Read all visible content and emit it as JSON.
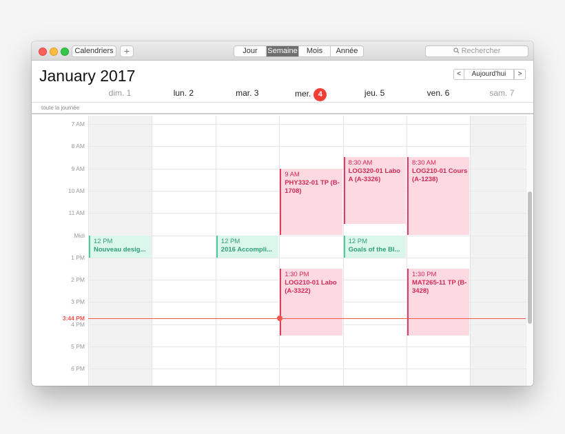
{
  "toolbar": {
    "calendars_label": "Calendriers",
    "add_label": "+",
    "views": [
      {
        "label": "Jour",
        "active": false
      },
      {
        "label": "Semaine",
        "active": true
      },
      {
        "label": "Mois",
        "active": false
      },
      {
        "label": "Année",
        "active": false
      }
    ],
    "search_placeholder": "Rechercher"
  },
  "header": {
    "month_title": "January 2017",
    "prev_label": "<",
    "today_label": "Aujourd'hui",
    "next_label": ">"
  },
  "days": [
    {
      "label": "dim. 1",
      "weekend": true
    },
    {
      "label": "lun. 2",
      "weekend": false
    },
    {
      "label": "mar. 3",
      "weekend": false
    },
    {
      "label": "mer.",
      "badge": "4",
      "weekend": false
    },
    {
      "label": "jeu. 5",
      "weekend": false
    },
    {
      "label": "ven. 6",
      "weekend": false
    },
    {
      "label": "sam. 7",
      "weekend": true
    }
  ],
  "all_day_label": "toute la journée",
  "hours": [
    "7 AM",
    "8 AM",
    "9 AM",
    "10 AM",
    "11 AM",
    "Midi",
    "1 PM",
    "2 PM",
    "3 PM",
    "4 PM",
    "5 PM",
    "6 PM"
  ],
  "first_hour": 7,
  "current_time": {
    "label": "3:44 PM",
    "hour": 15.733,
    "day_index": 3
  },
  "events": [
    {
      "day": 0,
      "start": 12,
      "end": 13,
      "time": "12 PM",
      "title": "Nouveau desig...",
      "color": "green"
    },
    {
      "day": 2,
      "start": 12,
      "end": 13,
      "time": "12 PM",
      "title": "2016 Accompli...",
      "color": "green"
    },
    {
      "day": 4,
      "start": 12,
      "end": 13,
      "time": "12 PM",
      "title": "Goals of the Bl...",
      "color": "green"
    },
    {
      "day": 3,
      "start": 9,
      "end": 12,
      "time": "9 AM",
      "title": "PHY332-01 TP (B-1708)",
      "color": "pink"
    },
    {
      "day": 4,
      "start": 8.5,
      "end": 11.5,
      "time": "8:30 AM",
      "title": "LOG320-01 Labo A (A-3326)",
      "color": "pink"
    },
    {
      "day": 5,
      "start": 8.5,
      "end": 12,
      "time": "8:30 AM",
      "title": "LOG210-01 Cours (A-1238)",
      "color": "pink"
    },
    {
      "day": 3,
      "start": 13.5,
      "end": 16.5,
      "time": "1:30 PM",
      "title": "LOG210-01 Labo (A-3322)",
      "color": "pink"
    },
    {
      "day": 5,
      "start": 13.5,
      "end": 16.5,
      "time": "1:30 PM",
      "title": "MAT265-11 TP (B-3428)",
      "color": "pink"
    }
  ],
  "colors": {
    "pink": "#e23b62",
    "green": "#4cc99a",
    "now": "#f2554d"
  }
}
